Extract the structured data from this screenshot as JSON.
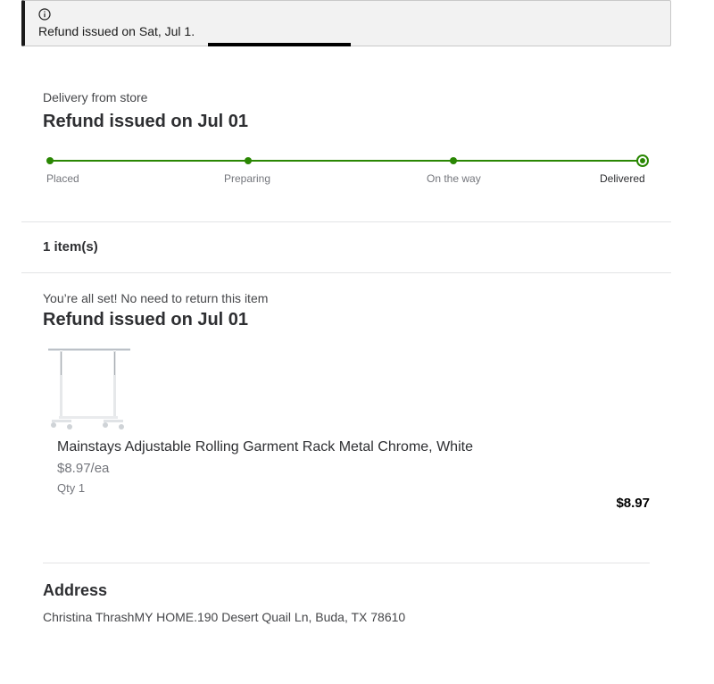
{
  "notice": {
    "icon": "info-icon",
    "text": "Refund issued on Sat, Jul 1."
  },
  "delivery": {
    "method": "Delivery from store",
    "status": "Refund issued on Jul 01",
    "steps": [
      "Placed",
      "Preparing",
      "On the way",
      "Delivered"
    ],
    "current_step": "Delivered",
    "accent": "#2a8703"
  },
  "items_summary": "1 item(s)",
  "item": {
    "return_note": "You’re all set! No need to return this item",
    "status": "Refund issued on Jul 01",
    "image_icon": "garment-rack-image",
    "name": "Mainstays Adjustable Rolling Garment Rack Metal Chrome, White",
    "unit_price": "$8.97/ea",
    "qty": "Qty 1",
    "total": "$8.97"
  },
  "address": {
    "title": "Address",
    "text": "Christina ThrashMY HOME.190 Desert Quail Ln, Buda, TX 78610"
  }
}
